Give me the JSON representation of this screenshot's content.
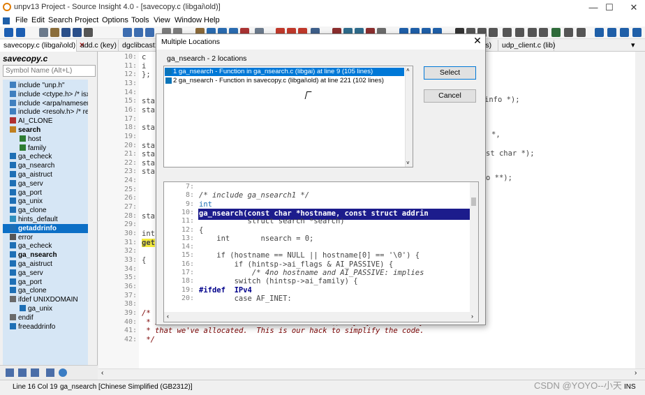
{
  "window": {
    "title": "unpv13 Project - Source Insight 4.0 - [savecopy.c (libgai\\old)]",
    "controls": [
      "—",
      "☐",
      "✕"
    ]
  },
  "menu": [
    "File",
    "Edit",
    "Search",
    "Project",
    "Options",
    "Tools",
    "View",
    "Window",
    "Help"
  ],
  "tabs": [
    {
      "label": "savecopy.c (libgai\\old)",
      "close": "✕",
      "active": true
    },
    {
      "label": "add.c (key)"
    },
    {
      "label": "dgclibcast1"
    },
    {
      "label": "ls)"
    },
    {
      "label": "udp_client.c (lib)"
    }
  ],
  "symbols": {
    "title": "savecopy.c",
    "search_placeholder": "Symbol Name (Alt+L)",
    "items": [
      {
        "label": "include \"unp.h\"",
        "icon": "include-icon"
      },
      {
        "label": "include <ctype.h> /* isx",
        "icon": "include-icon"
      },
      {
        "label": "include <arpa/nameser.",
        "icon": "include-icon"
      },
      {
        "label": "include <resolv.h> /* re",
        "icon": "include-icon"
      },
      {
        "label": "AI_CLONE",
        "icon": "define-icon"
      },
      {
        "label": "search",
        "icon": "struct-icon",
        "bold": true
      },
      {
        "label": "host",
        "icon": "member-icon",
        "indent": true
      },
      {
        "label": "family",
        "icon": "member-icon",
        "indent": true
      },
      {
        "label": "ga_echeck",
        "icon": "function-icon"
      },
      {
        "label": "ga_nsearch",
        "icon": "function-icon"
      },
      {
        "label": "ga_aistruct",
        "icon": "function-icon"
      },
      {
        "label": "ga_serv",
        "icon": "function-icon"
      },
      {
        "label": "ga_port",
        "icon": "function-icon"
      },
      {
        "label": "ga_unix",
        "icon": "function-icon"
      },
      {
        "label": "ga_clone",
        "icon": "function-icon"
      },
      {
        "label": "hints_default",
        "icon": "variable-icon"
      },
      {
        "label": "getaddrinfo",
        "icon": "function-icon",
        "selected": true
      },
      {
        "label": "error",
        "icon": "label-icon"
      },
      {
        "label": "ga_echeck",
        "icon": "function-icon"
      },
      {
        "label": "ga_nsearch",
        "icon": "function-icon",
        "bold": true
      },
      {
        "label": "ga_aistruct",
        "icon": "function-icon"
      },
      {
        "label": "ga_serv",
        "icon": "function-icon"
      },
      {
        "label": "ga_port",
        "icon": "function-icon"
      },
      {
        "label": "ga_clone",
        "icon": "function-icon"
      },
      {
        "label": "ifdef UNIXDOMAIN",
        "icon": "ifdef-icon"
      },
      {
        "label": "ga_unix",
        "icon": "function-icon",
        "indent": true
      },
      {
        "label": "endif",
        "icon": "ifdef-icon"
      },
      {
        "label": "freeaddrinfo",
        "icon": "function-icon"
      }
    ]
  },
  "editor": {
    "lines": [
      {
        "n": "10:",
        "code": "c"
      },
      {
        "n": "11:",
        "code": "i"
      },
      {
        "n": "12:",
        "code": "};"
      },
      {
        "n": "13:",
        "code": ""
      },
      {
        "n": "14:",
        "code": ""
      },
      {
        "n": "15:",
        "code": "sta"
      },
      {
        "n": "16:",
        "code": "sta"
      },
      {
        "n": "17:",
        "code": ""
      },
      {
        "n": "18:",
        "code": "sta"
      },
      {
        "n": "19:",
        "code": ""
      },
      {
        "n": "20:",
        "code": "sta"
      },
      {
        "n": "21:",
        "code": "sta"
      },
      {
        "n": "22:",
        "code": "sta"
      },
      {
        "n": "23:",
        "code": "sta"
      },
      {
        "n": "24:",
        "code": ""
      },
      {
        "n": "25:",
        "code": ""
      },
      {
        "n": "26:",
        "code": ""
      },
      {
        "n": "27:",
        "code": ""
      },
      {
        "n": "28:",
        "code": "sta"
      },
      {
        "n": "29:",
        "code": ""
      },
      {
        "n": "30:",
        "code": "int"
      },
      {
        "n": "31:",
        "code": "get"
      },
      {
        "n": "32:",
        "code": ""
      },
      {
        "n": "33:",
        "code": "{"
      },
      {
        "n": "34:",
        "code": ""
      },
      {
        "n": "35:",
        "code": ""
      },
      {
        "n": "36:",
        "code": ""
      },
      {
        "n": "37:",
        "code": ""
      },
      {
        "n": "38:",
        "code": ""
      },
      {
        "n": "39:",
        "code": "/*"
      },
      {
        "n": "40:",
        "code": " * If we encounter an error we want to free() any dynamic memory"
      },
      {
        "n": "41:",
        "code": " * that we've allocated.  This is our hack to simplify the code."
      },
      {
        "n": "42:",
        "code": " */"
      }
    ],
    "right_fragments": [
      "info *);",
      "*,",
      "st char *);",
      "o **);"
    ]
  },
  "dialog": {
    "title": "Multiple Locations",
    "close": "✕",
    "heading": "ga_nsearch - 2 locations",
    "locations": [
      "1 ga_nsearch - Function in ga_nsearch.c (libgai) at line 9 (105 lines)",
      "2 ga_nsearch - Function in savecopy.c (libgai\\old) at line 221 (102 lines)"
    ],
    "select_label": "Select",
    "cancel_label": "Cancel",
    "preview": [
      {
        "n": "7:",
        "code": ""
      },
      {
        "n": "8:",
        "code": "/* include ga_nsearch1 */"
      },
      {
        "n": "9:",
        "code": "int"
      },
      {
        "n": "10:",
        "code": "ga_nsearch(const char *hostname, const struct addrin"
      },
      {
        "n": "11:",
        "code": "           struct search *search)"
      },
      {
        "n": "12:",
        "code": "{"
      },
      {
        "n": "13:",
        "code": "    int       nsearch = 0;"
      },
      {
        "n": "14:",
        "code": ""
      },
      {
        "n": "15:",
        "code": "    if (hostname == NULL || hostname[0] == '\\0') {"
      },
      {
        "n": "16:",
        "code": "        if (hintsp->ai_flags & AI_PASSIVE) {"
      },
      {
        "n": "17:",
        "code": "            /* 4no hostname and AI_PASSIVE: implies"
      },
      {
        "n": "18:",
        "code": "        switch (hintsp->ai_family) {"
      },
      {
        "n": "19:",
        "code": "#ifdef  IPv4"
      },
      {
        "n": "20:",
        "code": "        case AF_INET:"
      }
    ]
  },
  "status": {
    "position": "Line 16  Col 19",
    "context": "ga_nsearch [Chinese Simplified (GB2312)]",
    "mode": "INS"
  },
  "watermark": "CSDN @YOYO--小天"
}
